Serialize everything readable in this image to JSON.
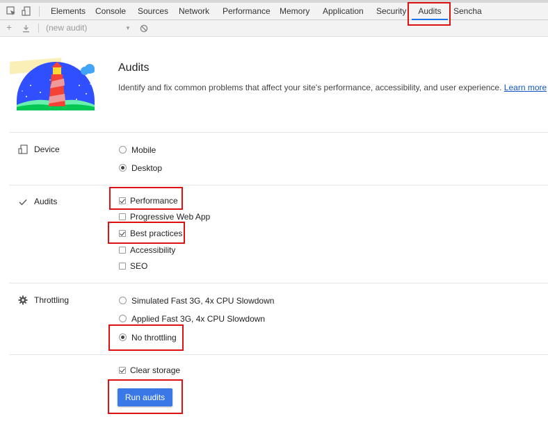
{
  "tabs": [
    "Elements",
    "Console",
    "Sources",
    "Network",
    "Performance",
    "Memory",
    "Application",
    "Security",
    "Audits",
    "Sencha"
  ],
  "active_tab": "Audits",
  "toolbar": {
    "audit_select": "(new audit)"
  },
  "header": {
    "title": "Audits",
    "description": "Identify and fix common problems that affect your site's performance, accessibility, and user experience.",
    "learn_more": "Learn more"
  },
  "sections": {
    "device": {
      "label": "Device",
      "options": [
        "Mobile",
        "Desktop"
      ],
      "selected": "Desktop"
    },
    "audits": {
      "label": "Audits",
      "options": [
        "Performance",
        "Progressive Web App",
        "Best practices",
        "Accessibility",
        "SEO"
      ],
      "checked": [
        "Performance",
        "Best practices"
      ]
    },
    "throttling": {
      "label": "Throttling",
      "options": [
        "Simulated Fast 3G, 4x CPU Slowdown",
        "Applied Fast 3G, 4x CPU Slowdown",
        "No throttling"
      ],
      "selected": "No throttling"
    }
  },
  "clear_storage": {
    "label": "Clear storage",
    "checked": true
  },
  "run_button": "Run audits",
  "colors": {
    "accent": "#1a73e8",
    "button": "#3b78e7",
    "highlight": "#dd1111"
  }
}
